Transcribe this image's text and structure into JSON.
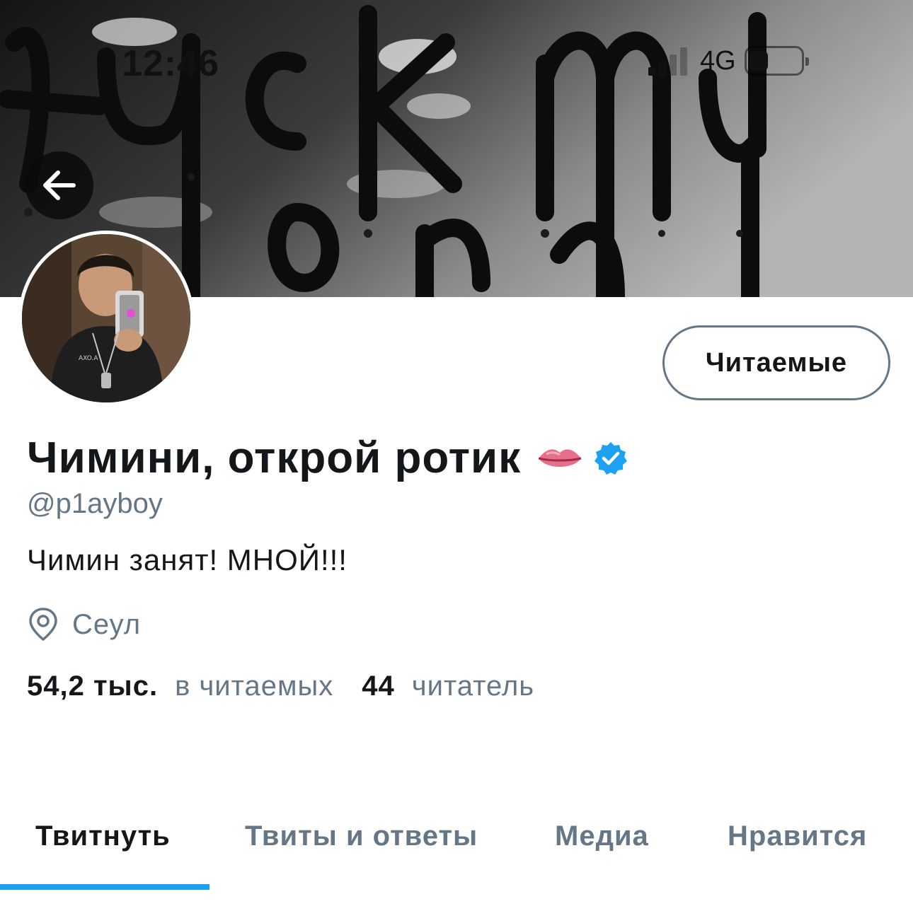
{
  "status_bar": {
    "time": "12:46",
    "network": "4G"
  },
  "banner": {
    "scrawl_text": "fuck my",
    "accent": "#1da1f2"
  },
  "header": {
    "back_icon": "arrow-left-icon"
  },
  "profile": {
    "display_name": "Чимини, открой ротик",
    "name_emoji": "👄",
    "verified_icon": "verified-badge-icon",
    "handle": "@p1ayboy",
    "bio": "Чимин занят! МНОЙ!!!",
    "location_icon": "location-pin-icon",
    "location": "Сеул",
    "following_count": "54,2 тыс.",
    "following_label": "в читаемых",
    "followers_count": "44",
    "followers_label": "читатель",
    "follow_button_label": "Читаемые"
  },
  "tabs": [
    {
      "label": "Твитнуть",
      "active": true
    },
    {
      "label": "Твиты и ответы",
      "active": false
    },
    {
      "label": "Медиа",
      "active": false
    },
    {
      "label": "Нравится",
      "active": false
    }
  ],
  "colors": {
    "text_primary": "#14171a",
    "text_secondary": "#657786",
    "accent": "#1da1f2",
    "verified": "#1da1f2"
  }
}
